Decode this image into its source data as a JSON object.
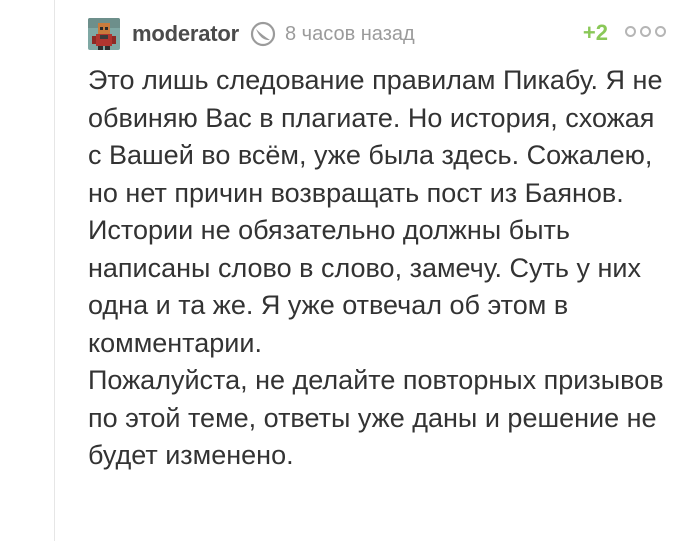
{
  "comment": {
    "author": "moderator",
    "time": "8 часов назад",
    "rating": "+2",
    "paragraphs": [
      "Это лишь следование правилам Пикабу. Я не обвиняю Вас в плагиате. Но история, схожая с Вашей во всём, уже была здесь. Сожалею, но нет причин возвращать пост из Баянов.",
      "Истории не обязательно должны быть написаны слово в слово, замечу. Суть у них одна и та же. Я уже отвечал об этом в комментарии.",
      "Пожалуйста, не делайте повторных призывов по этой теме, ответы уже даны и решение не будет изменено."
    ]
  },
  "colors": {
    "author": "#4b4b4b",
    "time": "#9b9b9b",
    "rating_positive": "#8ac858",
    "text": "#333333"
  },
  "icons": {
    "avatar": "avatar-image",
    "moderator_badge": "moderator-icon",
    "more": "more-dots-icon"
  }
}
